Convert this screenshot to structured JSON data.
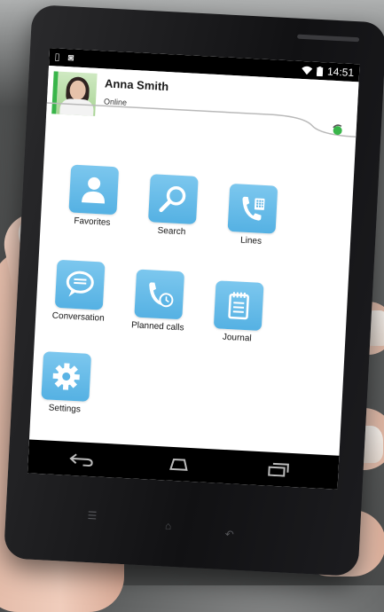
{
  "status_bar": {
    "time": "14:51",
    "left_icons": [
      "sim-icon",
      "camera-icon"
    ],
    "right_icons": [
      "wifi-icon",
      "battery-icon"
    ]
  },
  "contact": {
    "name": "Anna Smith",
    "status": "Online",
    "presence_color": "#39b54a"
  },
  "menu": [
    {
      "label": "Favorites",
      "icon": "person-icon"
    },
    {
      "label": "Search",
      "icon": "magnifier-icon"
    },
    {
      "label": "Lines",
      "icon": "phone-keypad-icon"
    },
    {
      "label": "Conversation",
      "icon": "speech-bubble-icon"
    },
    {
      "label": "Planned calls",
      "icon": "phone-clock-icon"
    },
    {
      "label": "Journal",
      "icon": "notepad-icon"
    },
    {
      "label": "Settings",
      "icon": "gear-icon"
    }
  ],
  "navbar": [
    "back-icon",
    "home-icon",
    "recent-apps-icon"
  ],
  "colors": {
    "tile": "#5bb4e5",
    "presence": "#39b54a",
    "phone_body": "#151517"
  }
}
